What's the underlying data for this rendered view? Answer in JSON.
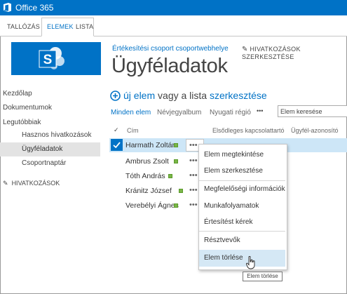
{
  "suite": {
    "title": "Office 365",
    "brand_color": "#0072c6"
  },
  "ribbon": {
    "tabs": [
      "TALLÓZÁS",
      "ELEMEK",
      "LISTA"
    ],
    "active": "ELEMEK"
  },
  "site": {
    "breadcrumb": "Értékesítési csoport csoportwebhelye",
    "page_title": "Ügyféladatok",
    "edit_links": "HIVATKOZÁSOK SZERKESZTÉSE"
  },
  "nav": {
    "items": [
      {
        "label": "Kezdőlap"
      },
      {
        "label": "Dokumentumok"
      },
      {
        "label": "Legutóbbiak"
      },
      {
        "label": "Hasznos hivatkozások"
      },
      {
        "label": "Ügyféladatok",
        "selected": true
      },
      {
        "label": "Csoportnaptár"
      }
    ],
    "edit_links": "HIVATKOZÁSOK"
  },
  "list": {
    "new_item": "új elem",
    "new_item_middle": "vagy a lista",
    "new_item_edit": "szerkesztése",
    "views": [
      "Minden elem",
      "Névjegyalbum",
      "Nyugati régió"
    ],
    "views_more": "•••",
    "search_placeholder": "Elem keresése",
    "columns": [
      "Cím",
      "Elsődleges kapcsolattartó",
      "Ügyfél-azonosító"
    ],
    "rows": [
      {
        "name": "Harmath Zoltán",
        "selected": true
      },
      {
        "name": "Ambrus Zsolt"
      },
      {
        "name": "Tóth András"
      },
      {
        "name": "Kránitz József"
      },
      {
        "name": "Verebélyi Ágnes"
      }
    ],
    "row_menu_dots": "•••"
  },
  "context_menu": {
    "items": [
      "Elem megtekintése",
      "Elem szerkesztése",
      "Megfelelőségi információk",
      "Munkafolyamatok",
      "Értesítést kérek",
      "Résztvevők",
      "Elem törlése"
    ],
    "hovered": "Elem törlése",
    "tooltip": "Elem törlése"
  }
}
